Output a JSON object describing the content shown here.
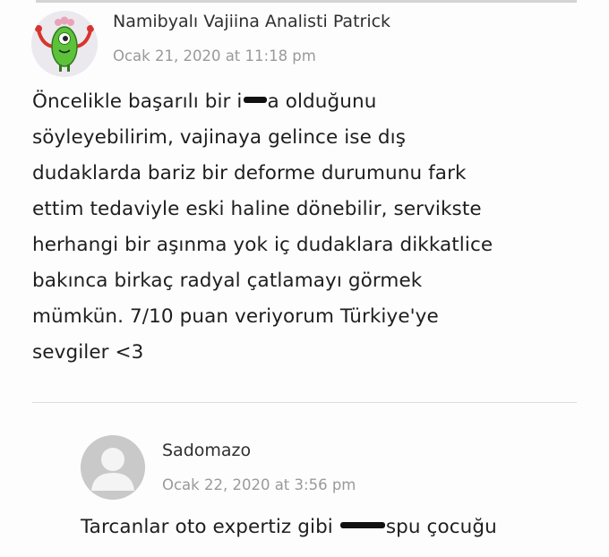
{
  "comments": [
    {
      "author": "Namibyalı Vajiina Analisti Patrick",
      "date": "Ocak 21, 2020 at 11:18 pm",
      "avatar_icon": "green-monster-avatar-icon",
      "body": {
        "l1a": "Öncelikle başarılı bir i",
        "l1b": "a olduğunu",
        "l2": "söyleyebilirim, vajinaya gelince ise dış",
        "l3": "dudaklarda bariz bir deforme durumunu fark",
        "l4": "ettim tedaviyle eski haline dönebilir, servikste",
        "l5": "herhangi bir aşınma yok iç dudaklara dikkatlice",
        "l6": "bakınca birkaç radyal çatlamayı görmek",
        "l7": "mümkün. 7/10 puan veriyorum Türkiye'ye",
        "l8": "sevgiler <3"
      }
    },
    {
      "author": "Sadomazo",
      "date": "Ocak 22, 2020 at 3:56 pm",
      "avatar_icon": "default-user-avatar-icon",
      "body": {
        "l1a": "Tarcanlar oto expertiz gibi ",
        "l1b": "spu çocuğu"
      }
    }
  ],
  "colors": {
    "author": "#2f2f2f",
    "date": "#9a9a9a",
    "body": "#1e1e1e",
    "redaction": "#111111",
    "avatar_placeholder": "#c9c9c9"
  }
}
